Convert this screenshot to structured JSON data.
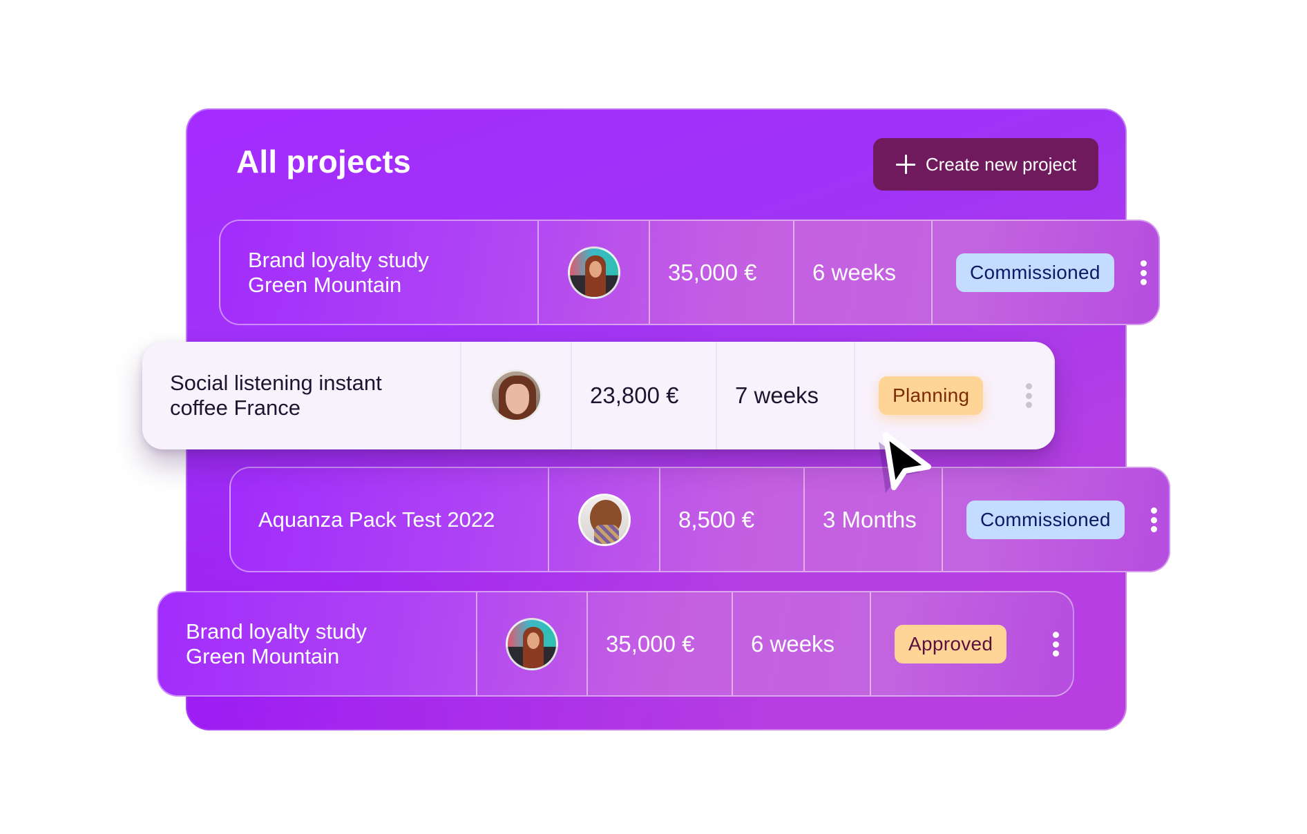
{
  "header": {
    "title": "All projects",
    "create_button_label": "Create new project",
    "create_button_icon": "plus-icon"
  },
  "colors": {
    "card_gradient_start": "#a42bff",
    "card_gradient_end": "#b93ee0",
    "create_button_bg": "#6e1a5c",
    "commissioned_bg": "#c4dcff",
    "commissioned_text": "#0b1a63",
    "planning_bg": "#ffd497",
    "planning_text": "#7a2a05",
    "approved_bg": "#ffd497",
    "approved_text": "#5a0f3c",
    "highlight_row_bg": "#f8f2fd"
  },
  "projects": [
    {
      "name_line1": "Brand loyalty study",
      "name_line2": "Green Mountain",
      "owner_avatar": "avatar-woman-red-hair",
      "budget": "35,000 €",
      "duration": "6 weeks",
      "status": "Commissioned",
      "menu_icon": "kebab-menu-icon"
    },
    {
      "name_line1": "Social listening instant",
      "name_line2": "coffee France",
      "owner_avatar": "avatar-woman-bangs",
      "budget": "23,800 €",
      "duration": "7 weeks",
      "status": "Planning",
      "menu_icon": "kebab-menu-icon",
      "highlighted": true
    },
    {
      "name_line1": "Aquanza Pack Test 2022",
      "name_line2": "",
      "owner_avatar": "avatar-woman-scarf",
      "budget": "8,500 €",
      "duration": "3 Months",
      "status": "Commissioned",
      "menu_icon": "kebab-menu-icon"
    },
    {
      "name_line1": "Brand loyalty study",
      "name_line2": "Green Mountain",
      "owner_avatar": "avatar-woman-red-hair",
      "budget": "35,000 €",
      "duration": "6 weeks",
      "status": "Approved",
      "menu_icon": "kebab-menu-icon"
    }
  ],
  "cursor": {
    "icon": "mouse-pointer-icon"
  }
}
